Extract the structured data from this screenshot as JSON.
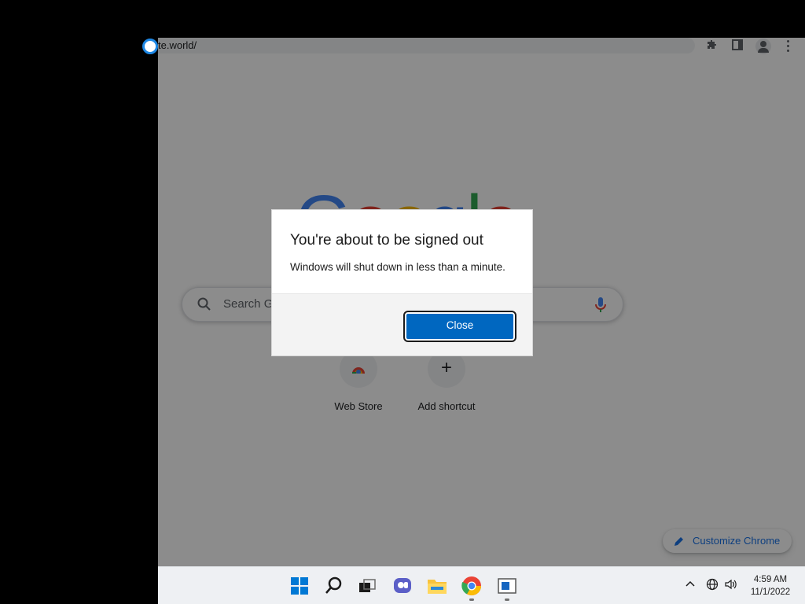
{
  "browser": {
    "url": "te.world/"
  },
  "ntp": {
    "logo": [
      "G",
      "o",
      "o",
      "g",
      "l",
      "e"
    ],
    "search_placeholder": "Search Google or type a URL",
    "shortcuts": [
      {
        "label": "Web Store",
        "icon": "chrome-web-store-icon"
      },
      {
        "label": "Add shortcut",
        "icon": "plus-icon"
      }
    ],
    "customize_label": "Customize Chrome"
  },
  "dialog": {
    "title": "You're about to be signed out",
    "message": "Windows will shut down in less than a minute.",
    "close_label": "Close"
  },
  "taskbar": {
    "apps": [
      "windows-start-icon",
      "search-icon",
      "task-view-icon",
      "chat-icon",
      "file-explorer-icon",
      "chrome-icon",
      "app-window-icon"
    ],
    "time": "4:59 AM",
    "date": "11/1/2022"
  },
  "colors": {
    "accent": "#0067c0",
    "google_blue": "#4285f4",
    "google_red": "#ea4335",
    "google_yellow": "#fbbc05",
    "google_green": "#34a853"
  }
}
